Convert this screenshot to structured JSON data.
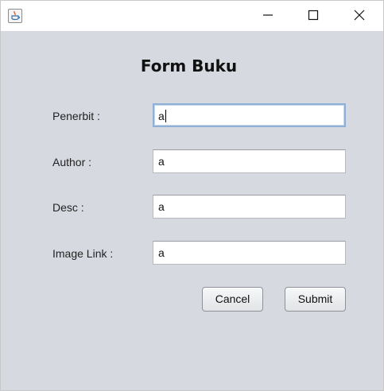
{
  "window": {
    "app_icon": "java-cup-icon",
    "controls": {
      "minimize_icon": "minimize-icon",
      "maximize_icon": "maximize-icon",
      "close_icon": "close-icon"
    }
  },
  "form": {
    "title": "Form Buku",
    "fields": [
      {
        "label": "Penerbit :",
        "value": "a"
      },
      {
        "label": "Author :",
        "value": "a"
      },
      {
        "label": "Desc :",
        "value": "a"
      },
      {
        "label": "Image Link :",
        "value": "a"
      }
    ],
    "buttons": {
      "cancel_label": "Cancel",
      "submit_label": "Submit"
    }
  }
}
